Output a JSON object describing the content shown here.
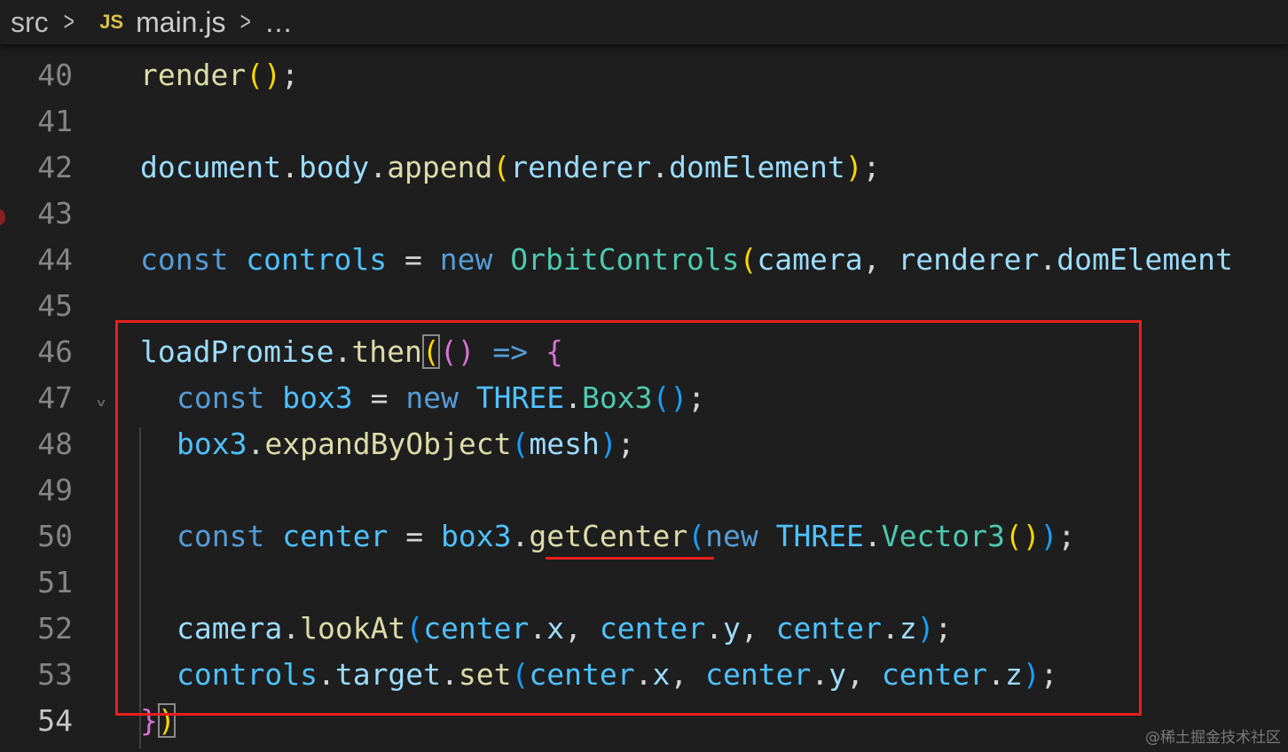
{
  "breadcrumb": {
    "folder": "src",
    "file_icon": "JS",
    "file": "main.js",
    "more": "…"
  },
  "code": {
    "line_numbers": [
      "40",
      "41",
      "42",
      "43",
      "44",
      "45",
      "46",
      "47",
      "48",
      "49",
      "50",
      "51",
      "52",
      "53",
      "54"
    ],
    "active_line": "54"
  },
  "watermark": "@稀土掘金技术社区",
  "colors": {
    "highlight": "#e8201e",
    "background": "#1e1e1e"
  }
}
